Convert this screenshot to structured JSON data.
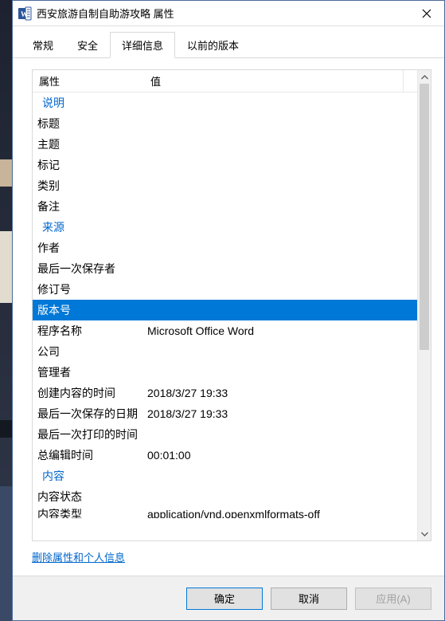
{
  "window": {
    "title": "西安旅游自制自助游攻略 属性"
  },
  "tabs": {
    "general": "常规",
    "security": "安全",
    "details": "详细信息",
    "previous": "以前的版本"
  },
  "columns": {
    "property": "属性",
    "value": "值"
  },
  "groups": {
    "description": "说明",
    "origin": "来源",
    "content": "内容"
  },
  "rows": {
    "title": {
      "label": "标题",
      "value": ""
    },
    "subject": {
      "label": "主题",
      "value": ""
    },
    "tags": {
      "label": "标记",
      "value": ""
    },
    "category": {
      "label": "类别",
      "value": ""
    },
    "comments": {
      "label": "备注",
      "value": ""
    },
    "author": {
      "label": "作者",
      "value": ""
    },
    "lastSavedBy": {
      "label": "最后一次保存者",
      "value": ""
    },
    "revision": {
      "label": "修订号",
      "value": ""
    },
    "version": {
      "label": "版本号",
      "value": ""
    },
    "program": {
      "label": "程序名称",
      "value": "Microsoft Office Word"
    },
    "company": {
      "label": "公司",
      "value": ""
    },
    "manager": {
      "label": "管理者",
      "value": ""
    },
    "created": {
      "label": "创建内容的时间",
      "value": "2018/3/27 19:33"
    },
    "lastSaved": {
      "label": "最后一次保存的日期",
      "value": "2018/3/27 19:33"
    },
    "lastPrinted": {
      "label": "最后一次打印的时间",
      "value": ""
    },
    "totalEdit": {
      "label": "总编辑时间",
      "value": "00:01:00"
    },
    "contentStatus": {
      "label": "内容状态",
      "value": ""
    },
    "contentType": {
      "label": "内容类型",
      "value": "application/vnd.openxmlformats-off"
    }
  },
  "link": {
    "removeProps": "删除属性和个人信息"
  },
  "buttons": {
    "ok": "确定",
    "cancel": "取消",
    "apply": "应用(A)"
  }
}
